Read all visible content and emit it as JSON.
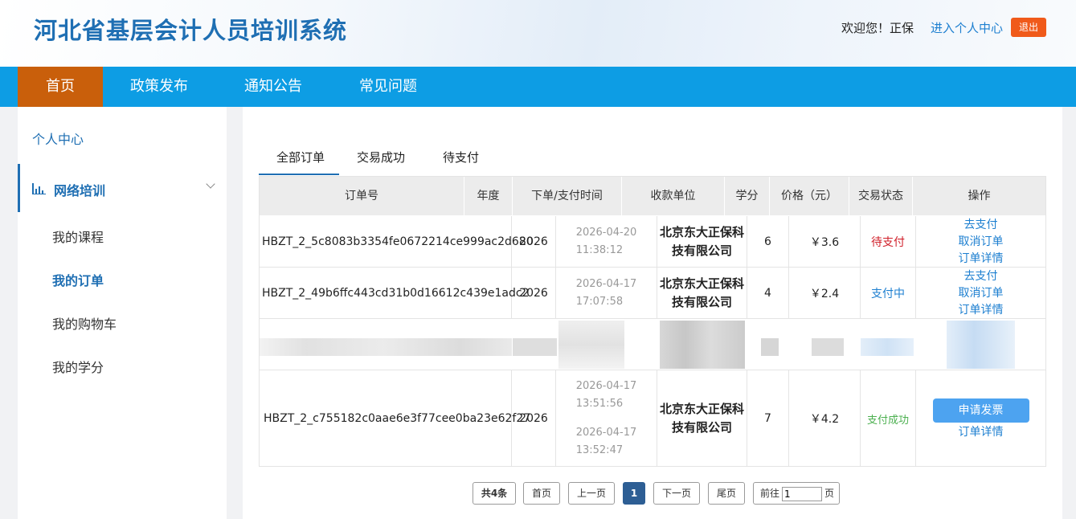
{
  "header": {
    "title": "河北省基层会计人员培训系统",
    "welcome": "欢迎您！正保",
    "personal_center_link": "进入个人中心",
    "logout": "退出"
  },
  "nav": {
    "items": [
      "首页",
      "政策发布",
      "通知公告",
      "常见问题"
    ],
    "active": "首页"
  },
  "sidebar": {
    "personal_center": "个人中心",
    "group": "网络培训",
    "items": [
      "我的课程",
      "我的订单",
      "我的购物车",
      "我的学分"
    ],
    "active": "我的订单"
  },
  "tabs": [
    "全部订单",
    "交易成功",
    "待支付"
  ],
  "table": {
    "headers": [
      "订单号",
      "年度",
      "下单/支付时间",
      "收款单位",
      "学分",
      "价格（元）",
      "交易状态",
      "操作"
    ],
    "rows": [
      {
        "order_no": "HBZT_2_5c8083b3354fe0672214ce999ac2d680",
        "year": "2026",
        "time1": "2026-04-20",
        "time2": "11:38:12",
        "payee_line1": "北京东大正保科",
        "payee_line2": "技有限公司",
        "credits": "6",
        "price": "￥3.6",
        "status": "待支付",
        "actions": [
          "去支付",
          "取消订单",
          "订单详情"
        ]
      },
      {
        "order_no": "HBZT_2_49b6ffc443cd31b0d16612c439e1adc2",
        "year": "2026",
        "time1": "2026-04-17",
        "time2": "17:07:58",
        "payee_line1": "北京东大正保科",
        "payee_line2": "技有限公司",
        "credits": "4",
        "price": "￥2.4",
        "status": "支付中",
        "actions": [
          "去支付",
          "取消订单",
          "订单详情"
        ]
      },
      {
        "order_no": "HBZT_2_c755182c0aae6e3f77cee0ba23e62f27",
        "year": "2026",
        "time1": "2026-04-17",
        "time2": "13:51:56",
        "time3": "2026-04-17",
        "time4": "13:52:47",
        "payee_line1": "北京东大正保科",
        "payee_line2": "技有限公司",
        "credits": "7",
        "price": "￥4.2",
        "status": "支付成功",
        "invoice_button": "申请发票",
        "detail_link": "订单详情"
      }
    ]
  },
  "pagination": {
    "total": "共4条",
    "first": "首页",
    "prev": "上一页",
    "current": "1",
    "next": "下一页",
    "last": "尾页",
    "goto_prefix": "前往",
    "goto_value": "1",
    "goto_suffix": "页"
  },
  "colors": {
    "nav_bg": "#0d9de4",
    "nav_active": "#c95f0b",
    "title": "#1f6fb3",
    "logout": "#f05a1a",
    "status_pending": "#d0202a",
    "status_paying": "#1d7fd0",
    "status_success": "#4cb050"
  }
}
